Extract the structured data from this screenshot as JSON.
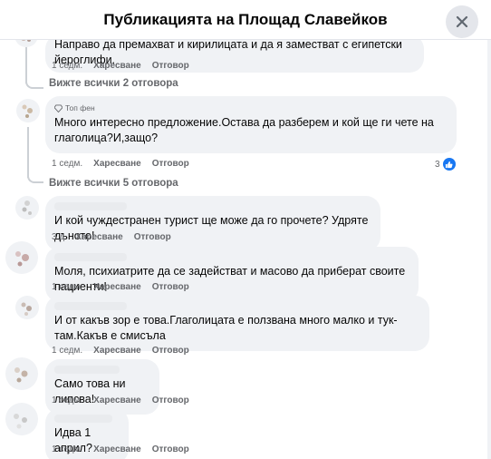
{
  "header": {
    "title": "Публикацията на Площад Славейков"
  },
  "top_fan_label": "Топ фен",
  "actions": {
    "like": "Харесване",
    "reply": "Отговор"
  },
  "comments": [
    {
      "text": "Направо да премахват и кирилицата и да я заместват с египетски йероглифи.",
      "time": "1 седм."
    },
    {
      "text": "Много интересно предложение.Остава да разберем и кой ще ги чете на глаголица?И,защо?",
      "time": "1 седм.",
      "reactions": "3"
    },
    {
      "text": "И кой чуждестранен турист ще може да го прочете? Удряте дъното!",
      "time": "3 д"
    },
    {
      "text": "Моля, психиатрите да се задействат и масово да приберат своите пациенти!",
      "time": "1 седм."
    },
    {
      "text": "И от какъв зор е това.Глаголицата е ползвана много малко и тук-там.Какъв е смисъла",
      "time": "1 седм."
    },
    {
      "text": "Само това ни липсва!",
      "time": "1 седм."
    },
    {
      "text": "Идва 1 април?",
      "time": "1 седм."
    }
  ],
  "view_replies": [
    "Вижте всички 2 отговора",
    "Вижте всички 5 отговора"
  ]
}
